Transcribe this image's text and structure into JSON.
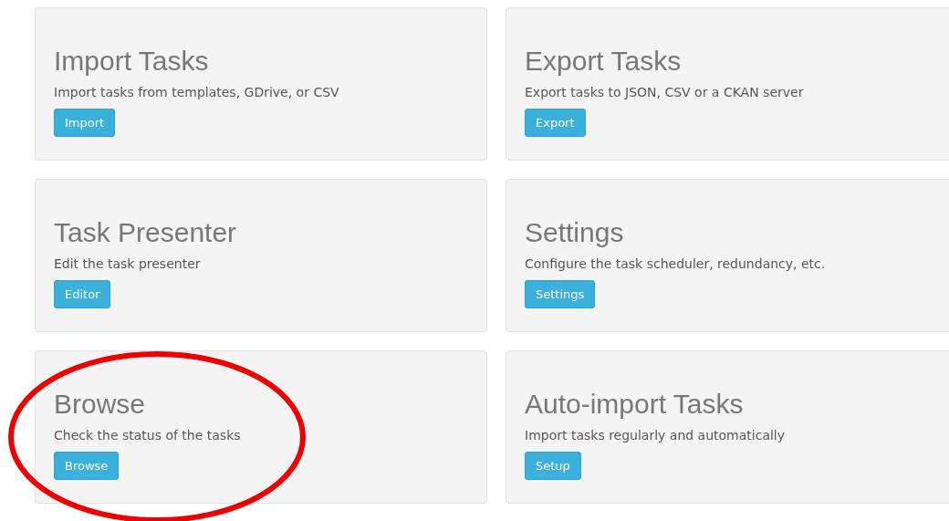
{
  "cards": [
    {
      "title": "Import Tasks",
      "description": "Import tasks from templates, GDrive, or CSV",
      "button": "Import",
      "circled": false
    },
    {
      "title": "Export Tasks",
      "description": "Export tasks to JSON, CSV or a CKAN server",
      "button": "Export",
      "circled": false
    },
    {
      "title": "Task Presenter",
      "description": "Edit the task presenter",
      "button": "Editor",
      "circled": false
    },
    {
      "title": "Settings",
      "description": "Configure the task scheduler, redundancy, etc.",
      "button": "Settings",
      "circled": false
    },
    {
      "title": "Browse",
      "description": "Check the status of the tasks",
      "button": "Browse",
      "circled": true
    },
    {
      "title": "Auto-import Tasks",
      "description": "Import tasks regularly and automatically",
      "button": "Setup",
      "circled": false
    }
  ]
}
